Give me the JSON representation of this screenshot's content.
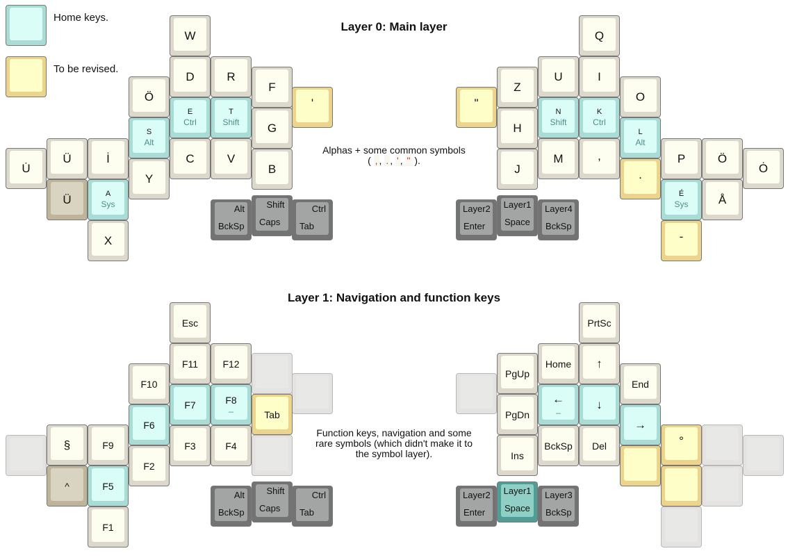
{
  "legend": {
    "home_keys": "Home keys.",
    "to_be_revised": "To be revised."
  },
  "layer0": {
    "title": "Layer 0: Main layer",
    "caption_line1": "Alphas + some common symbols",
    "caption_sym_open": "(",
    "caption_symbols": [
      ",",
      ".",
      "'",
      "\""
    ],
    "caption_sym_close": ")."
  },
  "layer1": {
    "title": "Layer 1: Navigation and function keys",
    "caption_line1": "Function keys, navigation and some",
    "caption_line2": "rare symbols (which didn't make it to",
    "caption_line3": "the symbol layer)."
  },
  "l0": {
    "W": "W",
    "D": "D",
    "R": "R",
    "F": "F",
    "apos": "'",
    "O_uml_left": "Ö",
    "E": "E",
    "E_sub": "Ctrl",
    "T": "T",
    "T_sub": "Shift",
    "G": "G",
    "S": "S",
    "S_sub": "Alt",
    "C": "C",
    "V": "V",
    "B": "B",
    "U_dot": "U̇",
    "U_uml": "Ü",
    "I_dot": "İ",
    "Y": "Y",
    "U_uml_beige": "Ü",
    "A": "A",
    "A_sub": "Sys",
    "X": "X",
    "Q": "Q",
    "Z": "Z",
    "U": "U",
    "I": "I",
    "O": "O",
    "quote": "\"",
    "H": "H",
    "N": "N",
    "N_sub": "Shift",
    "K": "K",
    "K_sub": "Ctrl",
    "L": "L",
    "L_sub": "Alt",
    "J": "J",
    "M": "M",
    "comma": ",",
    "period": ".",
    "P": "P",
    "O_uml": "Ö",
    "O_dot": "Ȯ",
    "E_acute": "É",
    "E_acute_sub": "Sys",
    "A_ring": "Å",
    "dash": "-"
  },
  "l1": {
    "Esc": "Esc",
    "F11": "F11",
    "F12": "F12",
    "F10": "F10",
    "F7": "F7",
    "F8": "F8",
    "F8_sub": "_",
    "Tab": "Tab",
    "F6": "F6",
    "section": "§",
    "F9": "F9",
    "F3": "F3",
    "F4": "F4",
    "F2": "F2",
    "caret": "^",
    "F5": "F5",
    "F1": "F1",
    "PrtSc": "PrtSc",
    "PgUp": "PgUp",
    "Home": "Home",
    "up": "↑",
    "End": "End",
    "PgDn": "PgDn",
    "left": "←",
    "left_sub": "_",
    "down": "↓",
    "right": "→",
    "Ins": "Ins",
    "BckSp": "BckSp",
    "Del": "Del",
    "degree": "°"
  },
  "thumbs": {
    "alt": "Alt",
    "bckspL": "BckSp",
    "shift": "Shift",
    "caps": "Caps",
    "ctrl": "Ctrl",
    "tab": "Tab",
    "layer2": "Layer2",
    "enter": "Enter",
    "layer1": "Layer1",
    "space": "Space",
    "layer4": "Layer4",
    "layer3": "Layer3",
    "bckspR": "BckSp"
  }
}
